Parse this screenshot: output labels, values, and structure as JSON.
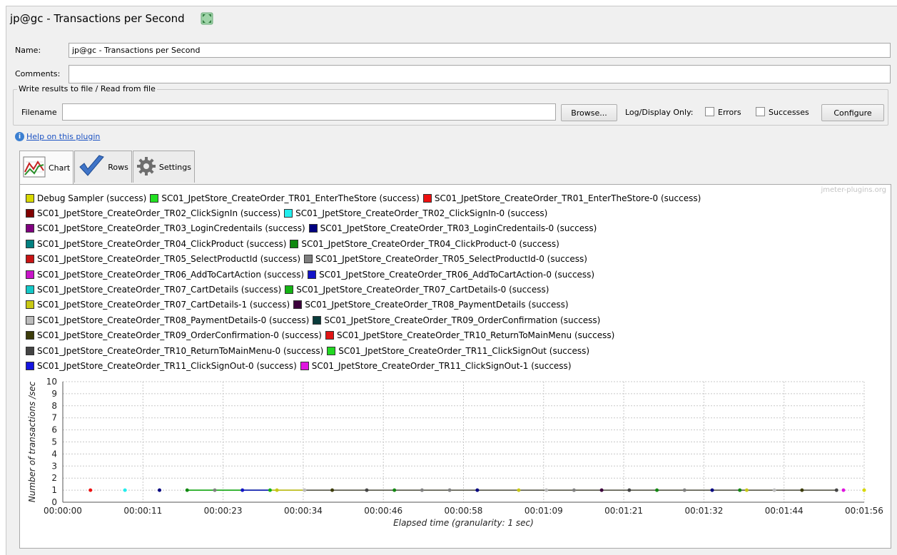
{
  "title": "jp@gc - Transactions per Second",
  "name": {
    "label": "Name:",
    "value": "jp@gc - Transactions per Second"
  },
  "comments": {
    "label": "Comments:",
    "value": ""
  },
  "file_section": {
    "legend": "Write results to file / Read from file",
    "filename_label": "Filename",
    "filename_value": "",
    "browse_label": "Browse...",
    "log_display_label": "Log/Display Only:",
    "errors_label": "Errors",
    "errors_checked": false,
    "successes_label": "Successes",
    "successes_checked": false,
    "configure_label": "Configure"
  },
  "help": {
    "icon": "info-icon",
    "link_text": "Help on this plugin"
  },
  "tabs": [
    {
      "label": "Chart",
      "icon": "chart-icon",
      "active": true
    },
    {
      "label": "Rows",
      "icon": "checkmark-icon",
      "active": false
    },
    {
      "label": "Settings",
      "icon": "gear-icon",
      "active": false
    }
  ],
  "watermark": "jmeter-plugins.org",
  "legend_rows": [
    [
      {
        "label": "Debug Sampler (success)",
        "color": "#d8d800"
      },
      {
        "label": "SC01_JpetStore_CreateOrder_TR01_EnterTheStore (success)",
        "color": "#22e022"
      },
      {
        "label": "SC01_JpetStore_CreateOrder_TR01_EnterTheStore-0 (success)",
        "color": "#ee1111"
      }
    ],
    [
      {
        "label": "SC01_JpetStore_CreateOrder_TR02_ClickSignIn (success)",
        "color": "#800000"
      },
      {
        "label": "SC01_JpetStore_CreateOrder_TR02_ClickSignIn-0 (success)",
        "color": "#22eeee"
      }
    ],
    [
      {
        "label": "SC01_JpetStore_CreateOrder_TR03_LoginCredentails (success)",
        "color": "#800080"
      },
      {
        "label": "SC01_JpetStore_CreateOrder_TR03_LoginCredentails-0 (success)",
        "color": "#000080"
      }
    ],
    [
      {
        "label": "SC01_JpetStore_CreateOrder_TR04_ClickProduct (success)",
        "color": "#008080"
      },
      {
        "label": "SC01_JpetStore_CreateOrder_TR04_ClickProduct-0 (success)",
        "color": "#118811"
      }
    ],
    [
      {
        "label": "SC01_JpetStore_CreateOrder_TR05_SelectProductId (success)",
        "color": "#c81414"
      },
      {
        "label": "SC01_JpetStore_CreateOrder_TR05_SelectProductId-0 (success)",
        "color": "#808080"
      }
    ],
    [
      {
        "label": "SC01_JpetStore_CreateOrder_TR06_AddToCartAction (success)",
        "color": "#c814c8"
      },
      {
        "label": "SC01_JpetStore_CreateOrder_TR06_AddToCartAction-0 (success)",
        "color": "#1414c8"
      }
    ],
    [
      {
        "label": "SC01_JpetStore_CreateOrder_TR07_CartDetails (success)",
        "color": "#14c8c8"
      },
      {
        "label": "SC01_JpetStore_CreateOrder_TR07_CartDetails-0 (success)",
        "color": "#14b414"
      }
    ],
    [
      {
        "label": "SC01_JpetStore_CreateOrder_TR07_CartDetails-1 (success)",
        "color": "#c8c814"
      },
      {
        "label": "SC01_JpetStore_CreateOrder_TR08_PaymentDetails (success)",
        "color": "#3c003c"
      }
    ],
    [
      {
        "label": "SC01_JpetStore_CreateOrder_TR08_PaymentDetails-0 (success)",
        "color": "#bcbcbc"
      },
      {
        "label": "SC01_JpetStore_CreateOrder_TR09_OrderConfirmation (success)",
        "color": "#0a3c3c"
      }
    ],
    [
      {
        "label": "SC01_JpetStore_CreateOrder_TR09_OrderConfirmation-0 (success)",
        "color": "#3c3c0a"
      },
      {
        "label": "SC01_JpetStore_CreateOrder_TR10_ReturnToMainMenu (success)",
        "color": "#e01414"
      }
    ],
    [
      {
        "label": "SC01_JpetStore_CreateOrder_TR10_ReturnToMainMenu-0 (success)",
        "color": "#444444"
      },
      {
        "label": "SC01_JpetStore_CreateOrder_TR11_ClickSignOut (success)",
        "color": "#22d822"
      }
    ],
    [
      {
        "label": "SC01_JpetStore_CreateOrder_TR11_ClickSignOut-0 (success)",
        "color": "#1414e0"
      },
      {
        "label": "SC01_JpetStore_CreateOrder_TR11_ClickSignOut-1 (success)",
        "color": "#e014e0"
      }
    ]
  ],
  "chart_data": {
    "type": "line",
    "title": "",
    "xlabel": "Elapsed time (granularity: 1 sec)",
    "ylabel": "Number of transactions /sec",
    "ylim": [
      0,
      10
    ],
    "xlim_seconds": [
      0,
      116
    ],
    "x_tick_labels": [
      "00:00:00",
      "00:00:11",
      "00:00:23",
      "00:00:34",
      "00:00:46",
      "00:00:58",
      "00:01:09",
      "00:01:21",
      "00:01:32",
      "00:01:44",
      "00:01:56"
    ],
    "y_tick_labels": [
      "0",
      "1",
      "2",
      "3",
      "4",
      "5",
      "6",
      "7",
      "8",
      "9",
      "10"
    ],
    "grid": true,
    "legend_position": "top",
    "points": [
      {
        "t": 4,
        "y": 1,
        "color": "#ee1111"
      },
      {
        "t": 9,
        "y": 1,
        "color": "#22eeee"
      },
      {
        "t": 14,
        "y": 1,
        "color": "#000080"
      },
      {
        "t": 18,
        "y": 1,
        "color": "#118811"
      },
      {
        "t": 22,
        "y": 1,
        "color": "#808080"
      },
      {
        "t": 26,
        "y": 1,
        "color": "#1414c8"
      },
      {
        "t": 30,
        "y": 1,
        "color": "#14b414"
      },
      {
        "t": 31,
        "y": 1,
        "color": "#c8c814"
      },
      {
        "t": 35,
        "y": 1,
        "color": "#bcbcbc"
      },
      {
        "t": 39,
        "y": 1,
        "color": "#3c3c0a"
      },
      {
        "t": 44,
        "y": 1,
        "color": "#444444"
      },
      {
        "t": 48,
        "y": 1,
        "color": "#118811"
      },
      {
        "t": 52,
        "y": 1,
        "color": "#808080"
      },
      {
        "t": 56,
        "y": 1,
        "color": "#808080"
      },
      {
        "t": 60,
        "y": 1,
        "color": "#000080"
      },
      {
        "t": 66,
        "y": 1,
        "color": "#c8c814"
      },
      {
        "t": 70,
        "y": 1,
        "color": "#bcbcbc"
      },
      {
        "t": 74,
        "y": 1,
        "color": "#808080"
      },
      {
        "t": 78,
        "y": 1,
        "color": "#3c003c"
      },
      {
        "t": 82,
        "y": 1,
        "color": "#444444"
      },
      {
        "t": 86,
        "y": 1,
        "color": "#118811"
      },
      {
        "t": 90,
        "y": 1,
        "color": "#808080"
      },
      {
        "t": 94,
        "y": 1,
        "color": "#000080"
      },
      {
        "t": 98,
        "y": 1,
        "color": "#118811"
      },
      {
        "t": 99,
        "y": 1,
        "color": "#c8c814"
      },
      {
        "t": 103,
        "y": 1,
        "color": "#bcbcbc"
      },
      {
        "t": 107,
        "y": 1,
        "color": "#3c3c0a"
      },
      {
        "t": 112,
        "y": 1,
        "color": "#444444"
      },
      {
        "t": 113,
        "y": 1,
        "color": "#e014e0"
      },
      {
        "t": 116,
        "y": 1,
        "color": "#d8d800"
      }
    ],
    "line_segments": [
      {
        "t_start": 18,
        "t_end": 112,
        "y": 1,
        "color": "#4a4a3a"
      },
      {
        "t_start": 18,
        "t_end": 30,
        "y": 1,
        "color": "#14b414"
      },
      {
        "t_start": 26,
        "t_end": 30,
        "y": 1,
        "color": "#1414c8"
      },
      {
        "t_start": 30,
        "t_end": 35,
        "y": 1,
        "color": "#c8c814"
      }
    ]
  }
}
